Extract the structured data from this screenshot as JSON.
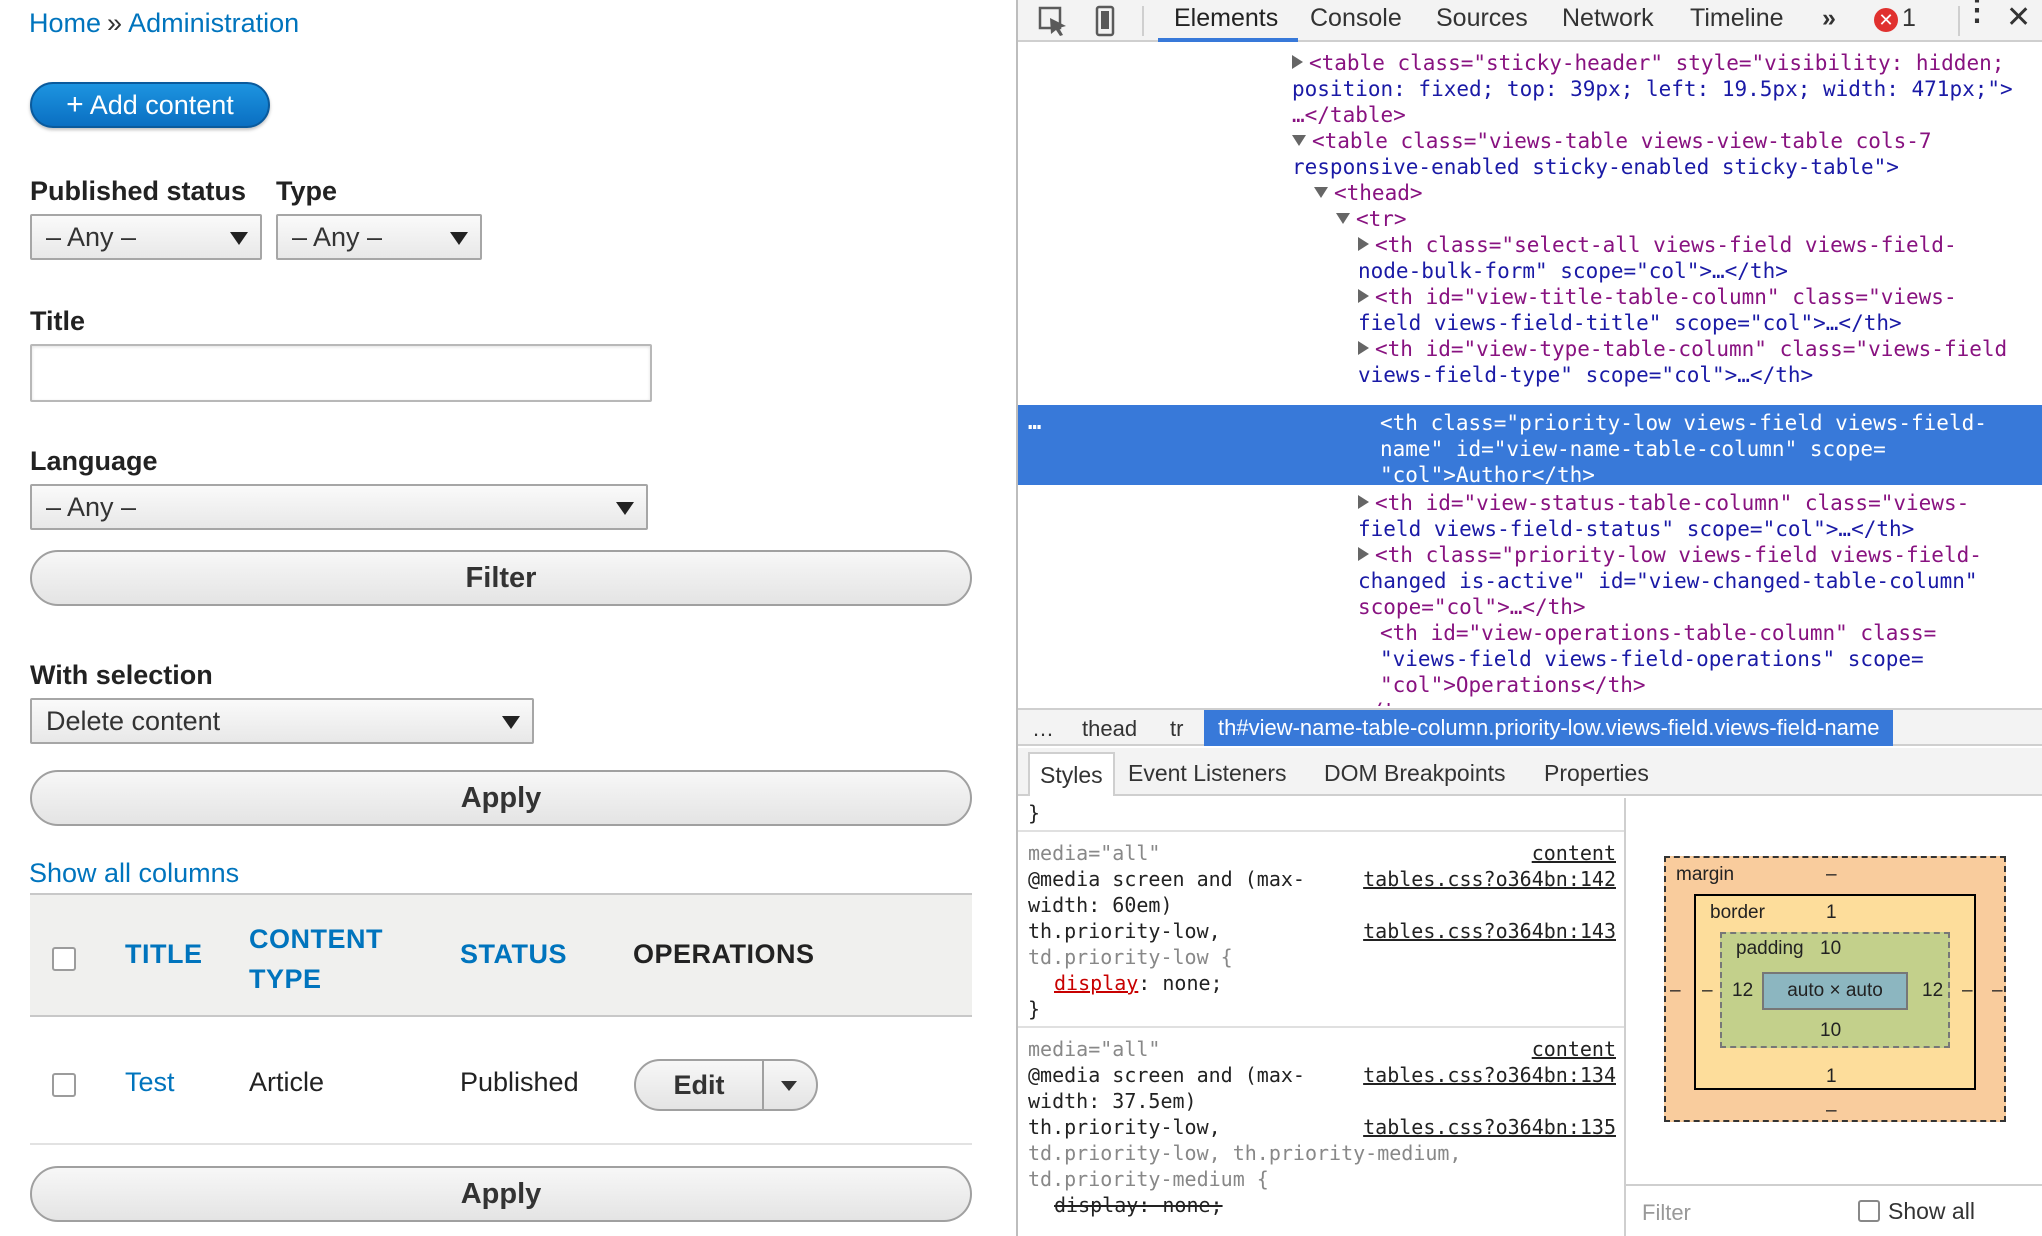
{
  "breadcrumb": {
    "home": "Home",
    "separator": "»",
    "admin": "Administration"
  },
  "add_content": {
    "plus": "+",
    "label": "Add content"
  },
  "filters": {
    "published_label": "Published status",
    "published_value": "– Any –",
    "type_label": "Type",
    "type_value": "– Any –",
    "title_label": "Title",
    "title_value": "",
    "language_label": "Language",
    "language_value": "– Any –",
    "filter_button": "Filter"
  },
  "bulk": {
    "label": "With selection",
    "action_value": "Delete content",
    "apply_button": "Apply",
    "apply_bottom_button": "Apply"
  },
  "show_all_columns": "Show all columns",
  "table": {
    "headers": {
      "title": "TITLE",
      "content_type_1": "CONTENT",
      "content_type_2": "TYPE",
      "status": "STATUS",
      "operations": "OPERATIONS"
    },
    "rows": [
      {
        "title": "Test",
        "type": "Article",
        "status": "Published",
        "edit": "Edit"
      }
    ]
  },
  "devtools": {
    "tabs": [
      "Elements",
      "Console",
      "Sources",
      "Network",
      "Timeline"
    ],
    "more": "»",
    "error_badge": "✕",
    "error_count": "1",
    "dom": {
      "l1": "<table class=\"sticky-header\" style=\"visibility: hidden;",
      "l1b": "position: fixed; top: 39px; left: 19.5px; width: 471px;\">",
      "l1c": "…</table>",
      "l2": "<table class=\"views-table views-view-table cols-7",
      "l2b": "responsive-enabled sticky-enabled sticky-table\">",
      "l3": "<thead>",
      "l4": "<tr>",
      "l5": "<th class=\"select-all views-field views-field-",
      "l5b": "node-bulk-form\" scope=\"col\">…</th>",
      "l6": "<th id=\"view-title-table-column\" class=\"views-",
      "l6b": "field views-field-title\" scope=\"col\">…</th>",
      "l7": "<th id=\"view-type-table-column\" class=\"views-field",
      "l7b": "views-field-type\" scope=\"col\">…</th>",
      "sel1": "<th class=\"priority-low views-field views-field-",
      "sel2": "name\" id=\"view-name-table-column\" scope=",
      "sel3": "\"col\">Author</th>",
      "l8": "<th id=\"view-status-table-column\" class=\"views-",
      "l8b": "field views-field-status\" scope=\"col\">…</th>",
      "l9": "<th class=\"priority-low views-field views-field-",
      "l9b": "changed is-active\" id=\"view-changed-table-column\"",
      "l9c": "scope=\"col\">…</th>",
      "l10": "<th id=\"view-operations-table-column\" class=",
      "l10b": "\"views-field views-field-operations\" scope=",
      "l10c": "\"col\">Operations</th>",
      "l11": "</tr>",
      "dots": "…"
    },
    "crumbs": {
      "dots": "…",
      "thead": "thead",
      "tr": "tr",
      "selected": "th#view-name-table-column.priority-low.views-field.views-field-name"
    },
    "subtabs": [
      "Styles",
      "Event Listeners",
      "DOM Breakpoints",
      "Properties"
    ],
    "styles": {
      "brace": "}",
      "r1_media": "media=\"all\"",
      "r1_src_top": "content",
      "r1_line1": "@media screen and (max-",
      "r1_src1": "tables.css?o364bn:142",
      "r1_line2": "width: 60em)",
      "r1_line3": "th.priority-low,",
      "r1_src2": "tables.css?o364bn:143",
      "r1_line4": "td.priority-low {",
      "r1_prop": "display",
      "r1_val": ": none;",
      "r1_close": "}",
      "r2_media": "media=\"all\"",
      "r2_src_top": "content",
      "r2_line1": "@media screen and (max-",
      "r2_src1": "tables.css?o364bn:134",
      "r2_line2": "width: 37.5em)",
      "r2_line3": "th.priority-low,",
      "r2_src2": "tables.css?o364bn:135",
      "r2_line4": "td.priority-low, th.priority-medium,",
      "r2_line5": "td.priority-medium {",
      "r2_strike": "display: none;"
    },
    "boxmodel": {
      "margin_label": "margin",
      "margin_top": "–",
      "margin_bottom": "–",
      "margin_left": "–",
      "margin_right": "–",
      "border_label": "border",
      "border_top": "1",
      "border_bottom": "1",
      "border_left": "–",
      "border_right": "–",
      "padding_label": "padding",
      "padding_top": "10",
      "padding_bottom": "10",
      "padding_left": "12",
      "padding_right": "12",
      "content": "auto × auto"
    },
    "filter_placeholder": "Filter",
    "show_all": "Show all"
  }
}
